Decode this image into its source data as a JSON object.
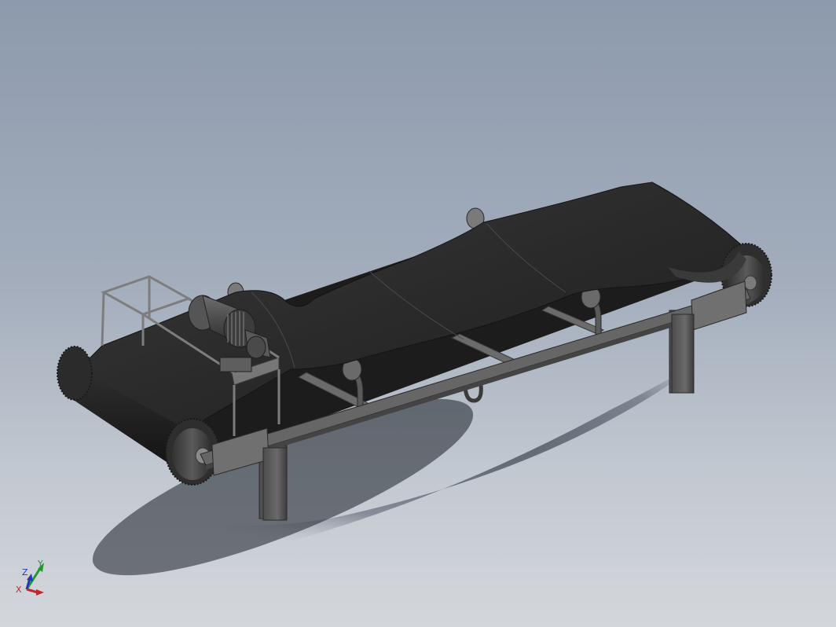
{
  "viewport": {
    "background_top": "#8d9aad",
    "background_bottom": "#d3d7dc"
  },
  "model": {
    "belt_color": "#2b2b2b",
    "frame_color": "#5e5e5e",
    "motor_color": "#4a4a4a"
  },
  "triad": {
    "x_label": "X",
    "y_label": "Y",
    "z_label": "Z",
    "x_color": "#c0262c",
    "y_color": "#1f9a2a",
    "z_color": "#2837b3"
  }
}
